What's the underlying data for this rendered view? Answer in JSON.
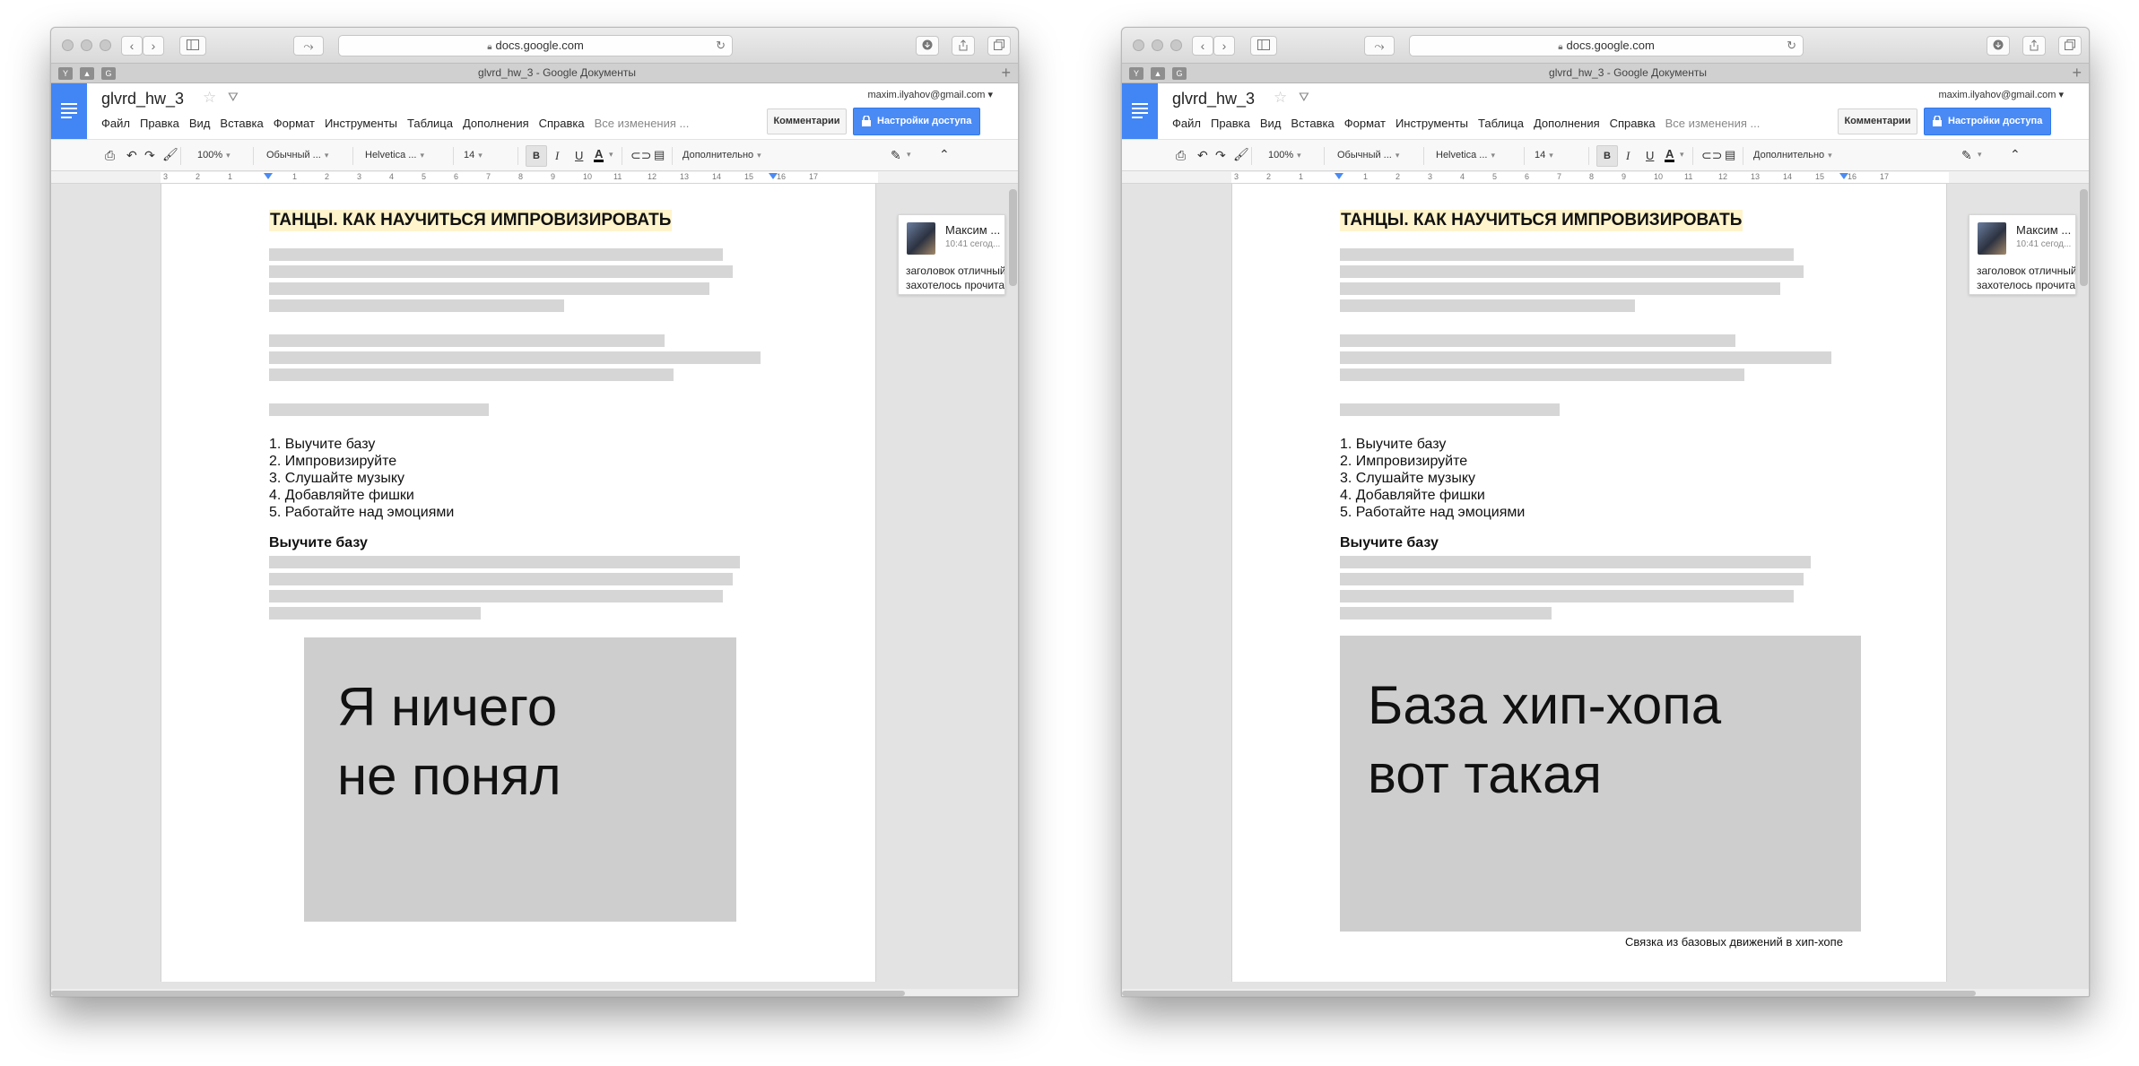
{
  "browser": {
    "url": "docs.google.com",
    "tab_title": "glvrd_hw_3 - Google Документы",
    "favicon_y": "Y",
    "favicon_g": "G"
  },
  "docs": {
    "title": "glvrd_hw_3",
    "account": "maxim.ilyahov@gmail.com ▾",
    "menu": [
      "Файл",
      "Правка",
      "Вид",
      "Вставка",
      "Формат",
      "Инструменты",
      "Таблица",
      "Дополнения",
      "Справка"
    ],
    "saved_status": "Все изменения ...",
    "comments_button": "Комментарии",
    "share_button": "Настройки доступа"
  },
  "toolbar": {
    "zoom": "100%",
    "style": "Обычный ...",
    "font": "Helvetica ...",
    "size": "14",
    "bold": "B",
    "italic": "I",
    "underline": "U",
    "text_color": "A",
    "more": "Дополнительно"
  },
  "ruler": {
    "ticks": [
      "3",
      "2",
      "1",
      "1",
      "2",
      "3",
      "4",
      "5",
      "6",
      "7",
      "8",
      "9",
      "10",
      "11",
      "12",
      "13",
      "14",
      "15",
      "16",
      "17"
    ]
  },
  "document": {
    "heading": "ТАНЦЫ. КАК НАУЧИТЬСЯ ИМПРОВИЗИРОВАТЬ",
    "list": [
      "1. Выучите базу",
      "2. Импровизируйте",
      "3. Слушайте музыку",
      "4. Добавляйте фишки",
      "5. Работайте над эмоциями"
    ],
    "subheading": "Выучите базу"
  },
  "comment": {
    "author": "Максим ...",
    "time": "10:41 сегод...",
    "line1": "заголовок отличный,",
    "line2": "захотелось прочитать"
  },
  "left": {
    "image_line1": "Я ничего",
    "image_line2": "не понял"
  },
  "right": {
    "image_line1": "База хип-хопа",
    "image_line2": "вот такая",
    "caption": "Связка из базовых движений в хип-хопе"
  },
  "colors": {
    "docs_blue": "#4285f4",
    "share_blue": "#4a8af4",
    "heading_highlight": "#fff4cc",
    "placeholder_gray": "#d6d6d6",
    "image_gray": "#cecece"
  }
}
